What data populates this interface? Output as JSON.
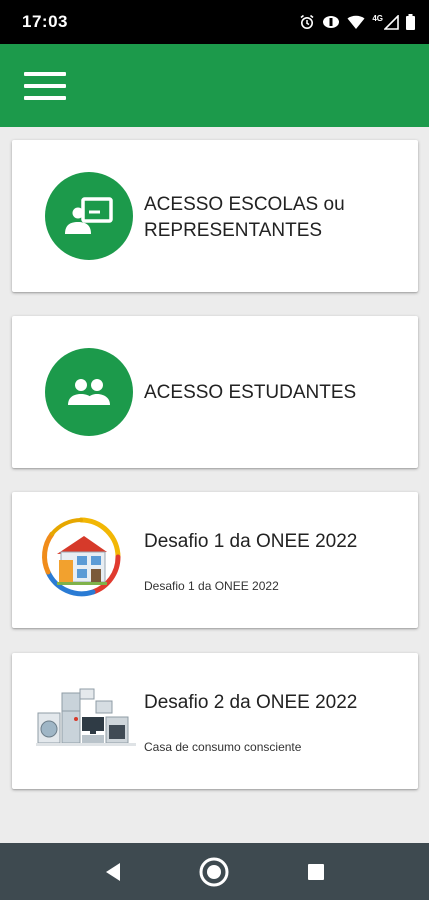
{
  "status_bar": {
    "time": "17:03",
    "network_label": "4G",
    "icons": [
      "alarm-icon",
      "data-saver-icon",
      "wifi-icon",
      "signal-icon",
      "battery-icon"
    ]
  },
  "app_bar": {
    "color": "#1c9a4b",
    "menu_icon": "hamburger-menu-icon"
  },
  "cards": [
    {
      "title": "ACESSO ESCOLAS ou REPRESENTANTES",
      "icon": "teacher-board-icon"
    },
    {
      "title": "ACESSO ESTUDANTES",
      "icon": "students-group-icon"
    },
    {
      "title": "Desafio 1 da ONEE 2022",
      "subtitle": "Desafio 1 da ONEE 2022",
      "image": "house-energy-image"
    },
    {
      "title": "Desafio 2 da ONEE 2022",
      "subtitle": "Casa de consumo consciente",
      "image": "appliances-image"
    }
  ],
  "nav_bar": {
    "buttons": [
      "back-icon",
      "home-icon",
      "recents-icon"
    ]
  },
  "colors": {
    "primary": "#1c9a4b",
    "background": "#ececec",
    "nav": "#3e4a50"
  }
}
